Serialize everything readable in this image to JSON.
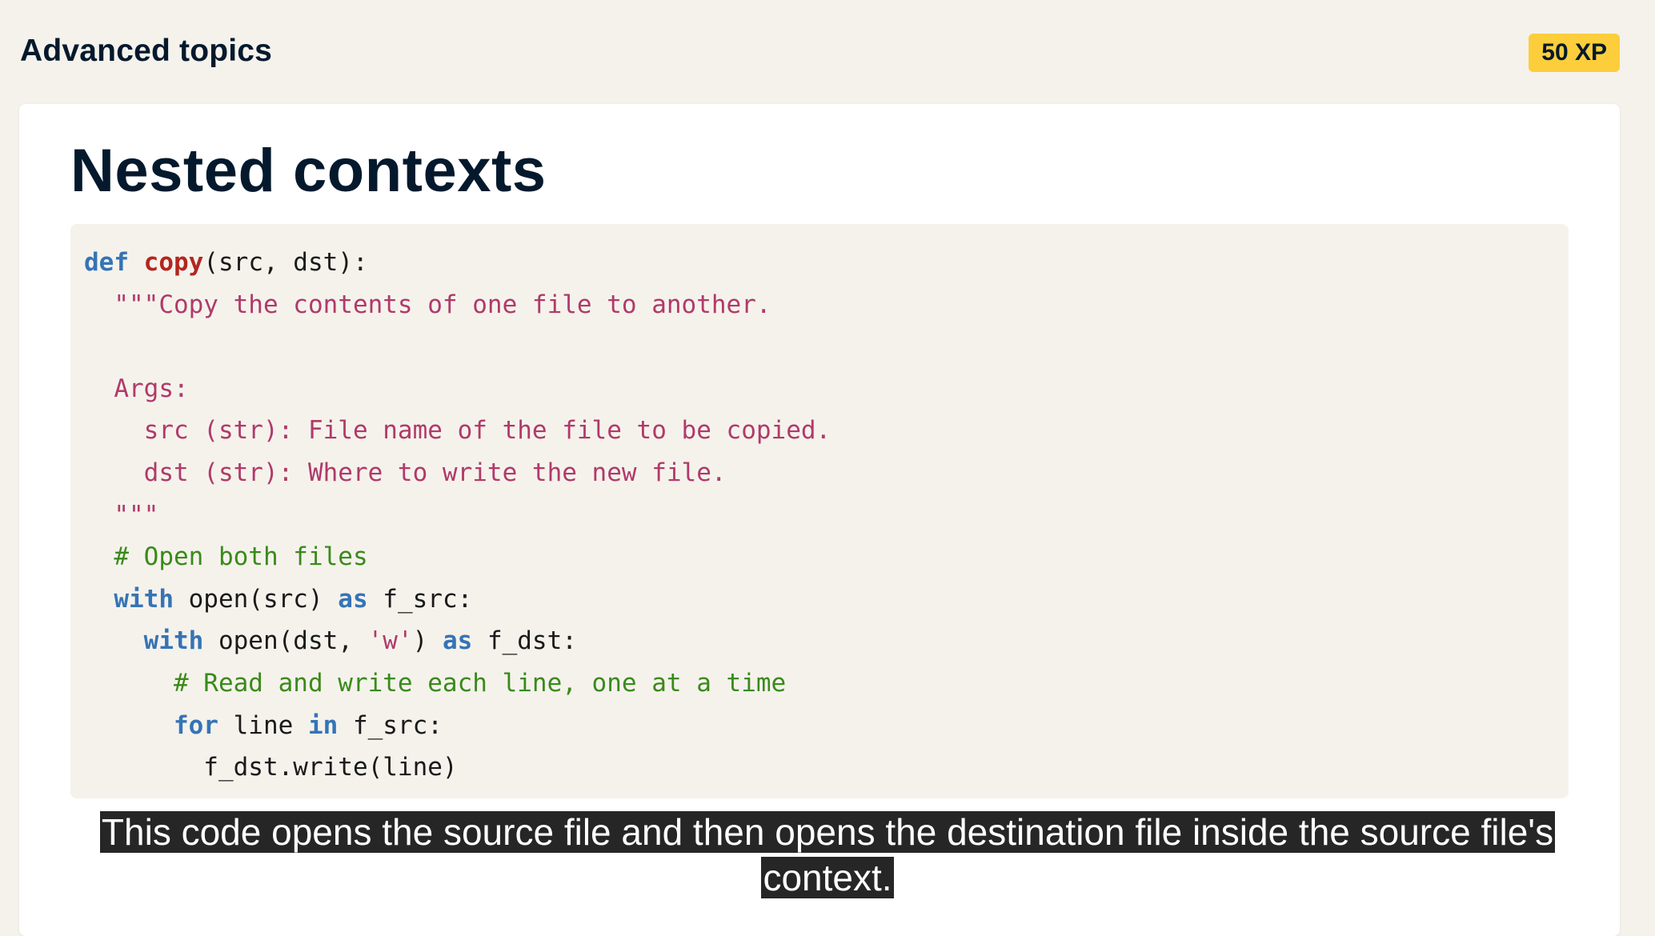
{
  "header": {
    "section_title": "Advanced topics",
    "xp_badge": "50 XP"
  },
  "slide": {
    "title": "Nested contexts",
    "code": {
      "line1": {
        "kw": "def",
        "fn": "copy",
        "rest": "(src, dst):"
      },
      "line2": {
        "str": "  \"\"\"Copy the contents of one file to another."
      },
      "line3": {
        "str": ""
      },
      "line4": {
        "str": "  Args:"
      },
      "line5": {
        "str": "    src (str): File name of the file to be copied."
      },
      "line6": {
        "str": "    dst (str): Where to write the new file."
      },
      "line7": {
        "str": "  \"\"\""
      },
      "line8": {
        "cm": "  # Open both files"
      },
      "line9": {
        "kw1": "with",
        "mid1": " open(src) ",
        "kw2": "as",
        "rest": " f_src:"
      },
      "line10": {
        "kw1": "with",
        "mid1": " open(dst, ",
        "str": "'w'",
        "mid2": ") ",
        "kw2": "as",
        "rest": " f_dst:"
      },
      "line11": {
        "cm": "      # Read and write each line, one at a time"
      },
      "line12": {
        "kw1": "for",
        "mid1": " line ",
        "kw2": "in",
        "rest": " f_src:"
      },
      "line13": {
        "rest": "        f_dst.write(line)"
      }
    }
  },
  "caption": {
    "line1": "This code opens the source file and then opens the destination file inside the source file's",
    "line2": "context."
  }
}
